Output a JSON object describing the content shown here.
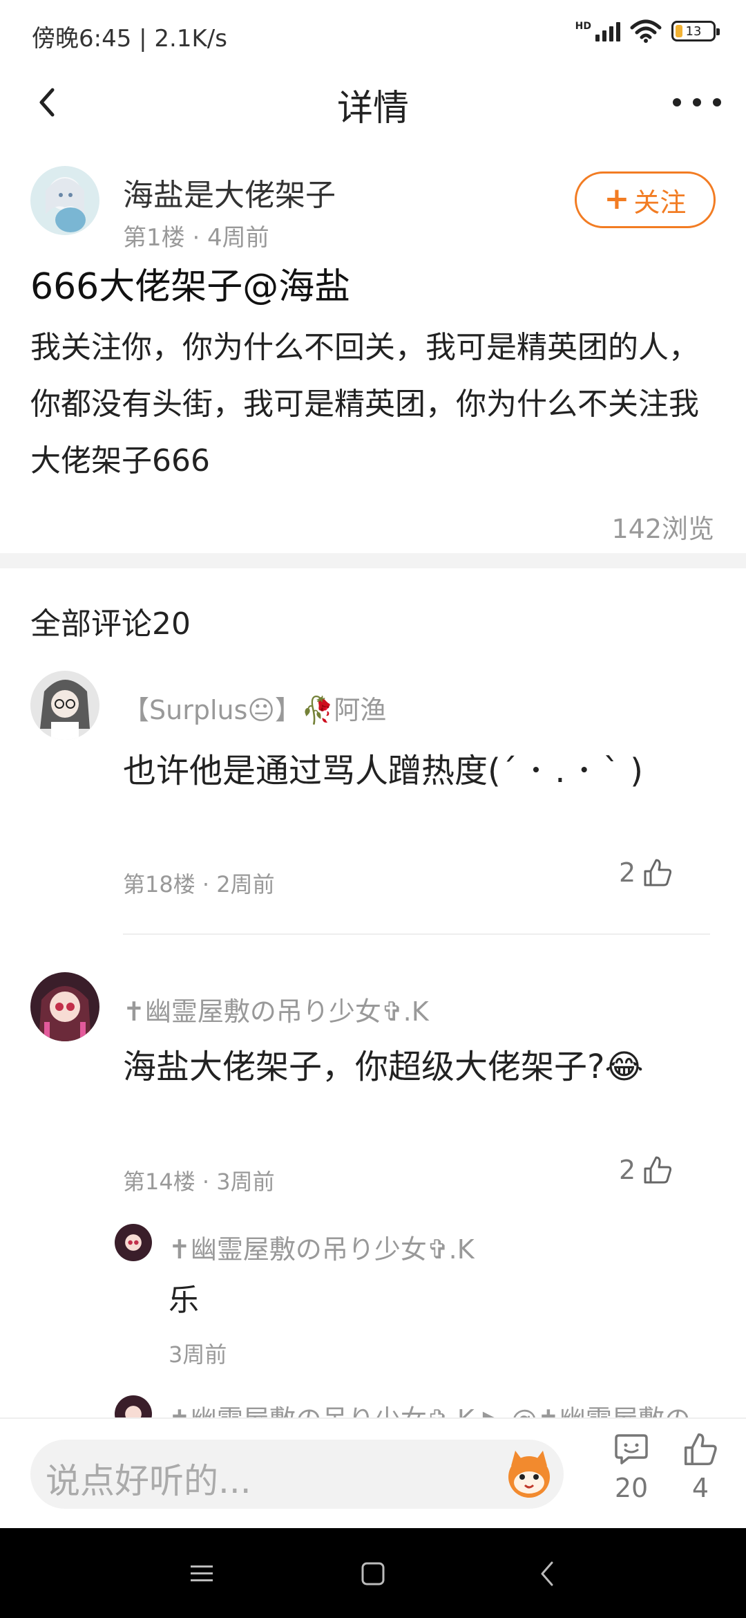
{
  "status": {
    "time_speed": "傍晚6:45 | 2.1K/s",
    "network": "HD",
    "battery": "13"
  },
  "header": {
    "title": "详情",
    "back_icon": "chevron-left-icon",
    "more_icon": "more-horizontal-icon"
  },
  "post": {
    "author_name": "海盐是大佬架子",
    "meta": "第1楼 · 4周前",
    "follow_label": "关注",
    "title": "666大佬架子@海盐",
    "body": "我关注你，你为什么不回关，我可是精英团的人，你都没有头街，我可是精英团，你为什么不关注我大佬架子666",
    "views": "142浏览"
  },
  "comments_heading": "全部评论20",
  "comments": [
    {
      "name": "【Surplus😐】🥀阿渔",
      "text": "也许他是通过骂人蹭热度(´ ･ . ･ ` )",
      "meta": "第18楼 · 2周前",
      "likes": "2"
    },
    {
      "name": "✝幽霊屋敷の吊り少女✞.K",
      "text": "海盐大佬架子，你超级大佬架子?😂",
      "meta": "第14楼 · 3周前",
      "likes": "2"
    }
  ],
  "replies": [
    {
      "name": "✝幽霊屋敷の吊り少女✞.K",
      "text": "乐",
      "meta": "3周前"
    },
    {
      "name": "✝幽霊屋敷の吊り少女✞.K ▶ @✝幽霊屋敷の"
    }
  ],
  "bottom_bar": {
    "placeholder": "说点好听的...",
    "comment_count": "20",
    "like_count": "4"
  },
  "nav": {
    "menu_icon": "menu-icon",
    "home_icon": "square-home-icon",
    "back_icon": "nav-back-icon"
  },
  "colors": {
    "accent": "#f27c23",
    "muted_text": "#999999",
    "divider": "#f3f3f3"
  }
}
